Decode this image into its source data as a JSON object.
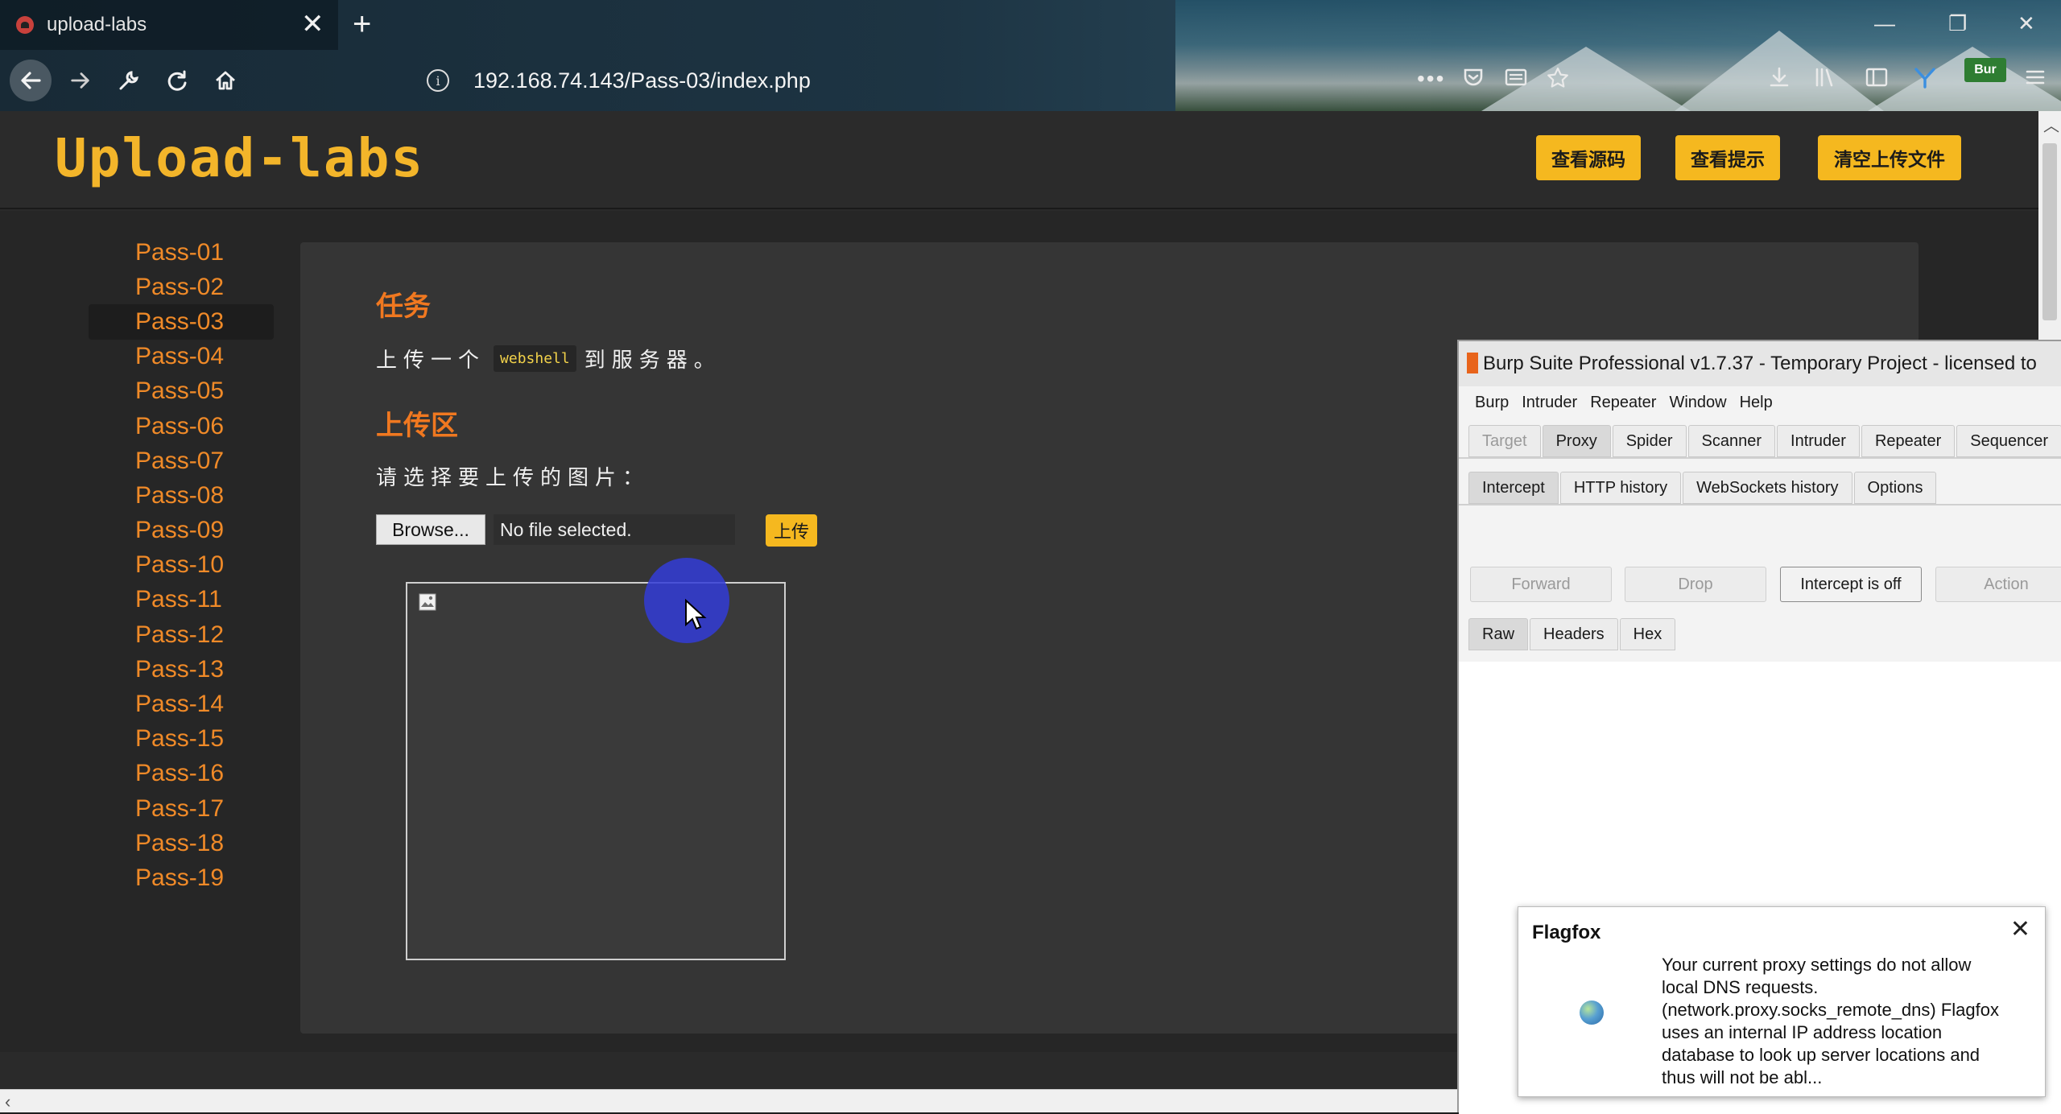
{
  "browser": {
    "tab_title": "upload-labs",
    "tab_close": "✕",
    "new_tab": "+",
    "url": "192.168.74.143/Pass-03/index.php",
    "page_actions": "•••",
    "burp_badge": "Bur",
    "icons": [
      "back-icon",
      "forward-icon",
      "wrench-icon",
      "reload-icon",
      "home-icon",
      "info-icon",
      "pocket-icon",
      "reader-icon",
      "bookmark-star-icon",
      "download-icon",
      "library-icon",
      "sidebar-icon",
      "foxyproxy-icon",
      "menu-icon"
    ]
  },
  "header": {
    "logo": "Upload-labs",
    "buttons": [
      "查看源码",
      "查看提示",
      "清空上传文件"
    ]
  },
  "sidebar": {
    "items": [
      "Pass-01",
      "Pass-02",
      "Pass-03",
      "Pass-04",
      "Pass-05",
      "Pass-06",
      "Pass-07",
      "Pass-08",
      "Pass-09",
      "Pass-10",
      "Pass-11",
      "Pass-12",
      "Pass-13",
      "Pass-14",
      "Pass-15",
      "Pass-16",
      "Pass-17",
      "Pass-18",
      "Pass-19"
    ],
    "active": "Pass-03"
  },
  "main": {
    "task_heading": "任务",
    "task_before": "上传一个",
    "task_code": "webshell",
    "task_after": "到服务器。",
    "upload_heading": "上传区",
    "choose_prompt": "请选择要上传的图片：",
    "browse_label": "Browse...",
    "file_status": "No file selected.",
    "upload_label": "上传"
  },
  "burp": {
    "title": "Burp Suite Professional v1.7.37 - Temporary Project - licensed to",
    "menu": [
      "Burp",
      "Intruder",
      "Repeater",
      "Window",
      "Help"
    ],
    "main_tabs": [
      "Target",
      "Proxy",
      "Spider",
      "Scanner",
      "Intruder",
      "Repeater",
      "Sequencer"
    ],
    "sub_tabs": [
      "Intercept",
      "HTTP history",
      "WebSockets history",
      "Options"
    ],
    "actions": [
      "Forward",
      "Drop",
      "Intercept is off",
      "Action"
    ],
    "view_tabs": [
      "Raw",
      "Headers",
      "Hex"
    ]
  },
  "flagfox": {
    "title": "Flagfox",
    "close": "✕",
    "message_lines": [
      "Your current proxy settings do not allow",
      "local DNS requests.",
      "(network.proxy.socks_remote_dns) Flagfox",
      "uses an internal IP address location",
      "database to look up server locations and",
      "thus will not be abl..."
    ]
  },
  "colors": {
    "accent": "#f5b81f",
    "sidebar_text": "#f08a28",
    "heading": "#f07820",
    "cursor_halo": "#3a46d8"
  }
}
